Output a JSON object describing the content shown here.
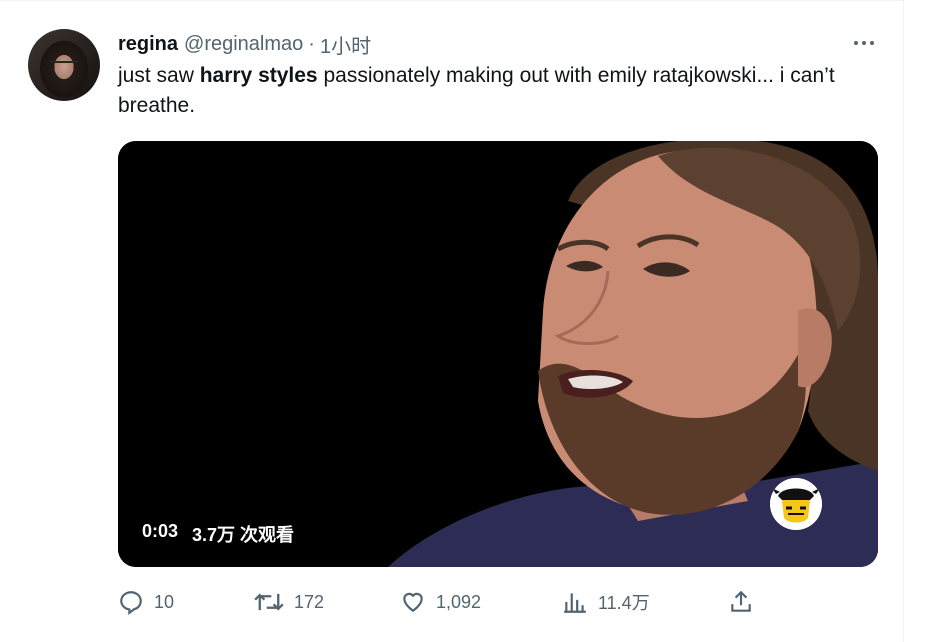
{
  "tweet": {
    "author_name": "regina",
    "author_handle": "@reginalmao",
    "separator": "·",
    "time": "1小时",
    "text_before": "just saw ",
    "text_bold": "harry styles",
    "text_after": " passionately making out with emily ratajkowski... i can’t breathe."
  },
  "video": {
    "timestamp": "0:03",
    "views": "3.7万 次观看"
  },
  "actions": {
    "reply_count": "10",
    "retweet_count": "172",
    "like_count": "1,092",
    "view_count": "11.4万"
  },
  "colors": {
    "text": "#0f1419",
    "secondary": "#536471",
    "border": "#eff3f4"
  }
}
